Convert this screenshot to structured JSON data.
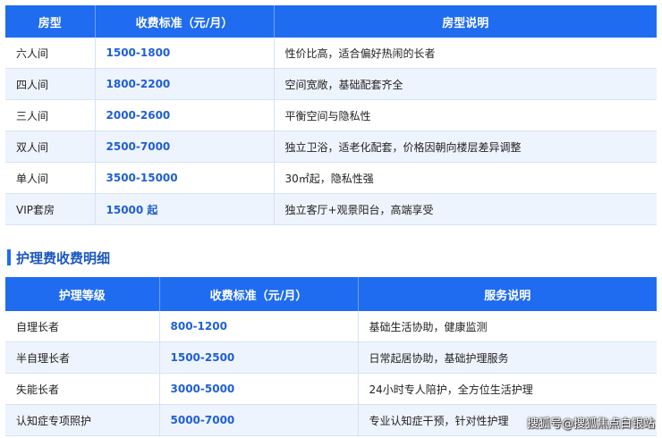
{
  "room_table": {
    "headers": [
      "房型",
      "收费标准（元/月）",
      "房型说明"
    ],
    "rows": [
      {
        "type": "六人间",
        "price": "1500-1800",
        "desc": "性价比高，适合偏好热闹的长者"
      },
      {
        "type": "四人间",
        "price": "1800-2200",
        "desc": "空间宽敞，基础配套齐全"
      },
      {
        "type": "三人间",
        "price": "2000-2600",
        "desc": "平衡空间与隐私性"
      },
      {
        "type": "双人间",
        "price": "2500-7000",
        "desc": "独立卫浴，适老化配套，价格因朝向楼层差异调整"
      },
      {
        "type": "单人间",
        "price": "3500-15000",
        "desc": "30㎡起，隐私性强"
      },
      {
        "type": "VIP套房",
        "price": "15000 起",
        "desc": "独立客厅+观景阳台，高端享受"
      }
    ]
  },
  "section": {
    "title": "护理费收费明细"
  },
  "nursing_table": {
    "headers": [
      "护理等级",
      "收费标准（元/月）",
      "服务说明"
    ],
    "rows": [
      {
        "level": "自理长者",
        "price": "800-1200",
        "desc": "基础生活协助，健康监测"
      },
      {
        "level": "半自理长者",
        "price": "1500-2500",
        "desc": "日常起居协助，基础护理服务"
      },
      {
        "level": "失能长者",
        "price": "3000-5000",
        "desc": "24小时专人陪护，全方位生活护理"
      },
      {
        "level": "认知症专项照护",
        "price": "5000-7000",
        "desc": "专业认知症干预，针对性护理"
      }
    ]
  },
  "watermark": "搜狐号@搜狐焦点白银站",
  "colors": {
    "header_bg": "#1f6cf0",
    "price_text": "#1f5fd6",
    "alt_row": "#eef4fd"
  }
}
